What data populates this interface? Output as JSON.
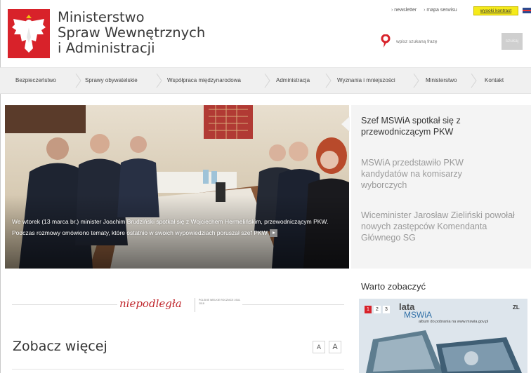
{
  "header": {
    "title_lines": [
      "Ministerstwo",
      "Spraw Wewnętrznych",
      "i Administracji"
    ],
    "top_links": [
      "newsletter",
      "mapa serwisu"
    ],
    "contrast_label": "wysoki kontrast",
    "language_flag": "flag-gb-icon",
    "search": {
      "placeholder": "wpisz szukaną frazę",
      "button_label": "szukaj"
    }
  },
  "nav": {
    "items": [
      "Bezpieczeństwo",
      "Sprawy obywatelskie",
      "Współpraca międzynarodowa",
      "Administracja",
      "Wyznania i mniejszości",
      "Ministerstwo",
      "Kontakt"
    ]
  },
  "hero": {
    "caption": "We wtorek (13 marca br.) minister Joachim Brudziński spotkał się z Wojciechem Hermelińskim, przewodniczącym PKW. Podczas rozmowy omówiono tematy, które ostatnio w swoich wypowiedziach poruszał szef PKW"
  },
  "side_news": [
    {
      "title": "Szef MSWiA spotkał się z przewodniczącym PKW",
      "active": true
    },
    {
      "title": "MSWiA przedstawiło PKW kandydatów na komisarzy wyborczych",
      "active": false
    },
    {
      "title": "Wiceminister Jarosław Zieliński powołał nowych zastępców Komendanta Głównego SG",
      "active": false
    }
  ],
  "niepodlegla": {
    "script_label": "niepodległa",
    "small_text": "POLSKIE WIELKIE ROCZNICE 1918-2018"
  },
  "more": {
    "title": "Zobacz więcej",
    "font_small": "A",
    "font_large": "A"
  },
  "warto": {
    "title": "Warto zobaczyć",
    "slides": [
      "1",
      "2",
      "3"
    ],
    "promo_lata": "lata",
    "promo_mswia": "MSWiA",
    "promo_album": "album do pobrania na www.mswia.gov.pl",
    "promo_badge": "ZL"
  },
  "colors": {
    "brand_red": "#d8222a",
    "contrast_yellow": "#f5ea1a",
    "nav_bg": "#f0f0f0",
    "side_bg": "#f4f4f4"
  }
}
